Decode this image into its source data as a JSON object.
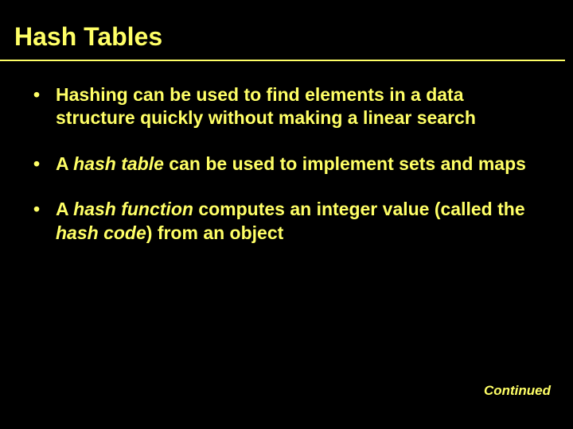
{
  "slide": {
    "title": "Hash Tables",
    "bullets": [
      {
        "pre": "Hashing can be used to find elements in a data structure quickly without making a linear search",
        "italic": "",
        "post": ""
      },
      {
        "pre": "A ",
        "italic": "hash table",
        "post": " can be used to implement sets and maps"
      },
      {
        "pre": "A ",
        "italic": "hash function",
        "post": " computes an integer value (called the ",
        "italic2": "hash code",
        "post2": ") from an object"
      }
    ],
    "footer": "Continued"
  }
}
